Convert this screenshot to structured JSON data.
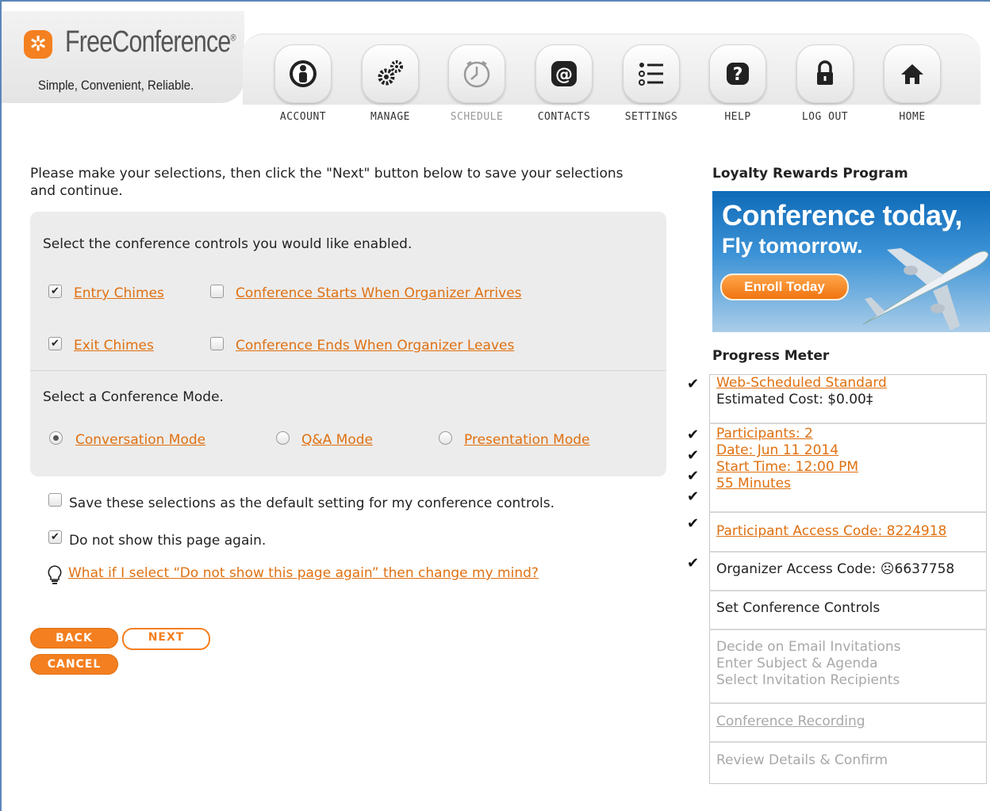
{
  "brand": {
    "name": "FreeConference",
    "registered": "®",
    "tagline": "Simple, Convenient, Reliable.",
    "accent_color": "#f47f20"
  },
  "nav": [
    {
      "label": "ACCOUNT",
      "icon": "account-icon"
    },
    {
      "label": "MANAGE",
      "icon": "gears-icon"
    },
    {
      "label": "SCHEDULE",
      "icon": "clock-icon",
      "dimmed": true
    },
    {
      "label": "CONTACTS",
      "icon": "at-sign-icon"
    },
    {
      "label": "SETTINGS",
      "icon": "list-icon"
    },
    {
      "label": "HELP",
      "icon": "question-icon"
    },
    {
      "label": "LOG OUT",
      "icon": "lock-icon"
    },
    {
      "label": "HOME",
      "icon": "home-icon"
    }
  ],
  "main": {
    "intro": "Please make your selections, then click the \"Next\" button below to save your selections and continue.",
    "controls_heading": "Select the conference controls you would like enabled.",
    "controls": [
      {
        "label": "Entry Chimes",
        "checked": true
      },
      {
        "label": "Conference Starts When Organizer Arrives",
        "checked": false
      },
      {
        "label": "Exit Chimes",
        "checked": true
      },
      {
        "label": "Conference Ends When Organizer Leaves",
        "checked": false
      }
    ],
    "mode_heading": "Select a Conference Mode.",
    "modes": [
      {
        "label": "Conversation Mode",
        "selected": true
      },
      {
        "label": "Q&A Mode",
        "selected": false
      },
      {
        "label": "Presentation Mode",
        "selected": false
      }
    ],
    "save_default_label": "Save these selections as the default setting for my conference controls.",
    "save_default_checked": false,
    "dont_show_label": "Do not show this page again.",
    "dont_show_checked": true,
    "help_link": "What if I select “Do not show this page again” then change my mind?",
    "buttons": {
      "back": "BACK",
      "next": "NEXT",
      "cancel": "CANCEL"
    }
  },
  "sidebar": {
    "rewards_title": "Loyalty Rewards Program",
    "banner": {
      "headline": "Conference today,",
      "subline": "Fly tomorrow.",
      "cta": "Enroll Today"
    },
    "progress_title": "Progress Meter",
    "progress": {
      "plan_link": "Web-Scheduled Standard",
      "estimated_cost": "Estimated Cost: $0.00‡",
      "participants": "Participants: 2",
      "date": "Date: Jun 11 2014",
      "start_time": "Start Time: 12:00 PM",
      "duration": "55 Minutes",
      "participant_code": "Participant Access Code: 8224918",
      "organizer_code": "Organizer Access Code: ☹6637758",
      "current_step": "Set Conference Controls",
      "email_lines": [
        "Decide on Email Invitations",
        "Enter Subject & Agenda",
        "Select Invitation Recipients"
      ],
      "recording": "Conference Recording",
      "review": "Review Details & Confirm"
    },
    "checkmark": "✔"
  }
}
